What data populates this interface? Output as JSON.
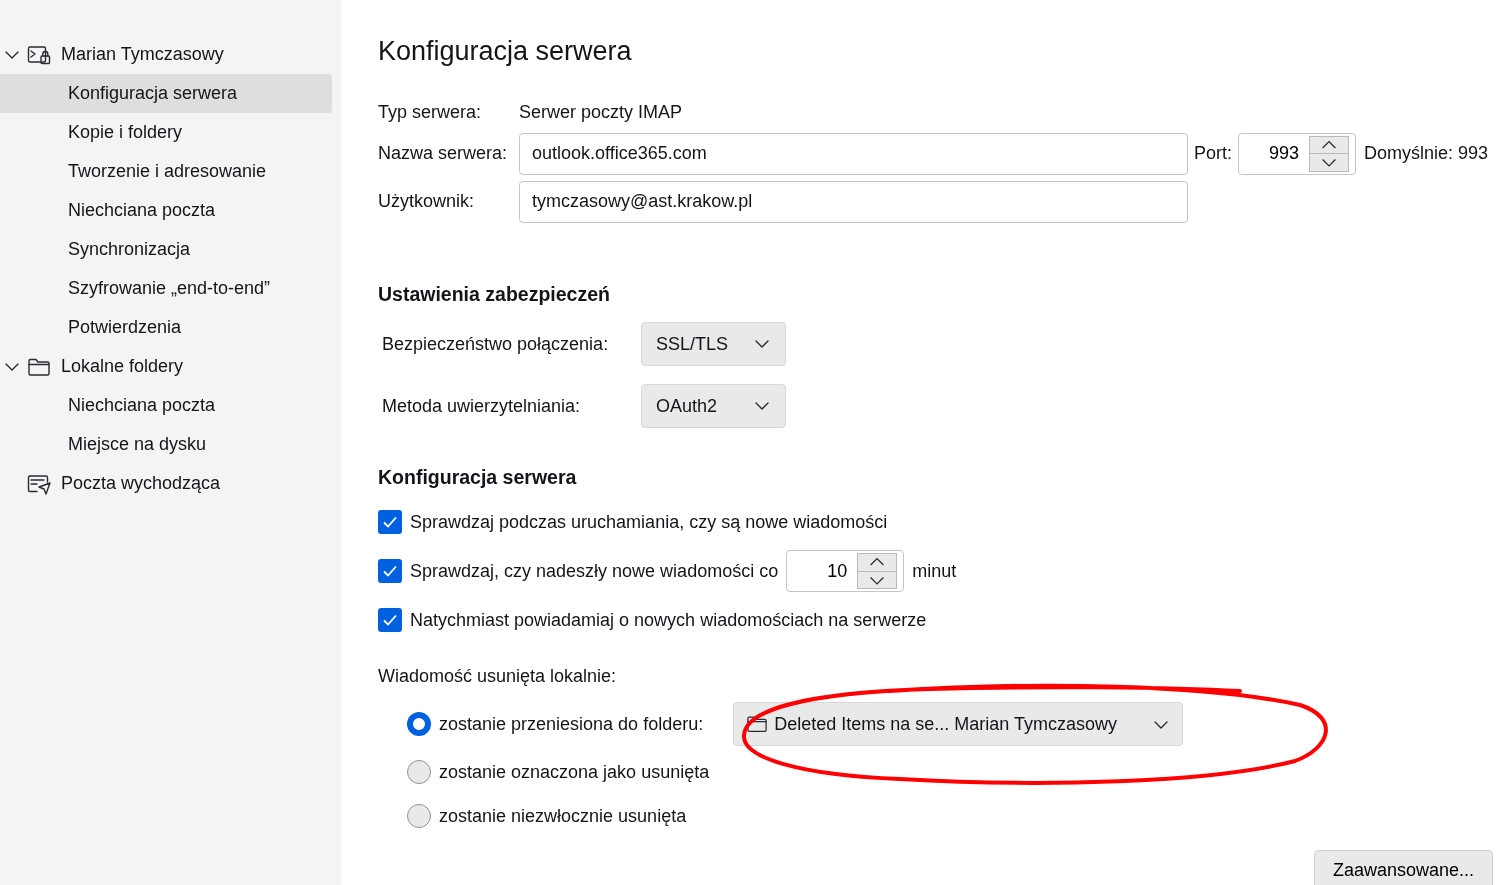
{
  "sidebar": {
    "items": [
      {
        "label": "Marian Tymczasowy",
        "kind": "account",
        "expanded": true,
        "selected": false,
        "children": [
          {
            "label": "Konfiguracja serwera",
            "selected": true
          },
          {
            "label": "Kopie i foldery",
            "selected": false
          },
          {
            "label": "Tworzenie i adresowanie",
            "selected": false
          },
          {
            "label": "Niechciana poczta",
            "selected": false
          },
          {
            "label": "Synchronizacja",
            "selected": false
          },
          {
            "label": "Szyfrowanie „end-to-end”",
            "selected": false
          },
          {
            "label": "Potwierdzenia",
            "selected": false
          }
        ]
      },
      {
        "label": "Lokalne foldery",
        "kind": "folder",
        "expanded": true,
        "selected": false,
        "children": [
          {
            "label": "Niechciana poczta",
            "selected": false
          },
          {
            "label": "Miejsce na dysku",
            "selected": false
          }
        ]
      },
      {
        "label": "Poczta wychodząca",
        "kind": "outgoing",
        "selected": false
      }
    ]
  },
  "page_title": "Konfiguracja serwera",
  "server_type": {
    "label": "Typ serwera:",
    "value": "Serwer poczty IMAP"
  },
  "server_name": {
    "label": "Nazwa serwera:",
    "value": "outlook.office365.com"
  },
  "port": {
    "label": "Port:",
    "value": "993",
    "default": "Domyślnie: 993"
  },
  "user": {
    "label": "Użytkownik:",
    "value": "tymczasowy@ast.krakow.pl"
  },
  "security": {
    "heading": "Ustawienia zabezpieczeń",
    "fields": [
      {
        "label": "Bezpieczeństwo połączenia:",
        "value": "SSL/TLS"
      },
      {
        "label": "Metoda uwierzytelniania:",
        "value": "OAuth2"
      }
    ]
  },
  "server_settings": {
    "heading": "Konfiguracja serwera",
    "checks": [
      {
        "kind": "plain",
        "label": "Sprawdzaj podczas uruchamiania, czy są nowe wiadomości",
        "checked": true
      },
      {
        "kind": "interval",
        "label": "Sprawdzaj, czy nadeszły nowe wiadomości co",
        "checked": true,
        "value": "10",
        "suffix": "minut"
      },
      {
        "kind": "plain",
        "label": "Natychmiast powiadamiaj o nowych wiadomościach na serwerze",
        "checked": true
      }
    ]
  },
  "deleted": {
    "label": "Wiadomość usunięta lokalnie:",
    "options": [
      {
        "label": "zostanie przeniesiona do folderu:",
        "selected": true,
        "folder": "Deleted Items na se... Marian Tymczasowy"
      },
      {
        "label": "zostanie oznaczona jako usunięta",
        "selected": false
      },
      {
        "label": "zostanie niezwłocznie usunięta",
        "selected": false
      }
    ]
  },
  "advanced_button": "Zaawansowane..."
}
